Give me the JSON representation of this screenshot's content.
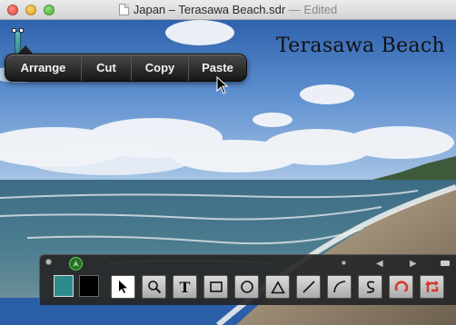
{
  "window": {
    "title_name": "Japan – Terasawa Beach.sdr",
    "title_status": "— Edited"
  },
  "canvas": {
    "caption": "Terasawa Beach"
  },
  "context_menu": {
    "items": [
      {
        "label": "Arrange"
      },
      {
        "label": "Cut"
      },
      {
        "label": "Copy"
      },
      {
        "label": "Paste"
      }
    ]
  },
  "palette": {
    "fill_color": "#2e8a8c",
    "stroke_color": "#000000",
    "tools": [
      {
        "name": "arrow-select",
        "icon": "arrow-pointer-icon",
        "active": true
      },
      {
        "name": "zoom",
        "icon": "magnifier-icon"
      },
      {
        "name": "text",
        "icon": "text-icon",
        "glyph": "T"
      },
      {
        "name": "rectangle",
        "icon": "rectangle-icon"
      },
      {
        "name": "oval",
        "icon": "circle-icon"
      },
      {
        "name": "triangle",
        "icon": "triangle-icon"
      },
      {
        "name": "line",
        "icon": "line-icon"
      },
      {
        "name": "arc",
        "icon": "arc-icon"
      },
      {
        "name": "freehand",
        "icon": "squiggle-icon"
      },
      {
        "name": "rotate",
        "icon": "rotate-icon"
      },
      {
        "name": "flip",
        "icon": "flip-arrows-icon"
      }
    ]
  },
  "colors": {
    "accent": "#2e8a8c",
    "tool_red": "#d9382e"
  }
}
